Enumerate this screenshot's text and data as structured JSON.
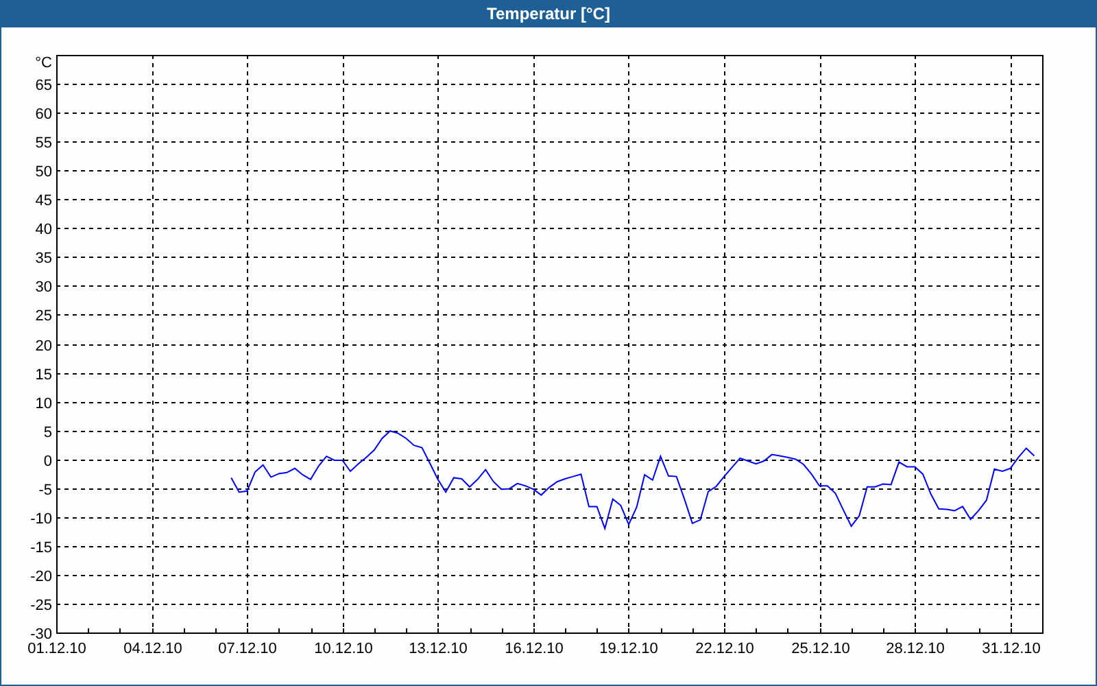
{
  "window": {
    "title": "Temperatur [°C]"
  },
  "chart": {
    "chart_data": {
      "type": "line",
      "grid": true,
      "ylabel": "°C",
      "ylim": [
        -30,
        70
      ],
      "categories": [
        "01.12.10",
        null,
        null,
        null,
        null,
        null,
        null,
        null,
        null,
        null,
        null,
        null,
        "04.12.10",
        null,
        null,
        null,
        null,
        null,
        null,
        null,
        null,
        null,
        null,
        null,
        "07.12.10",
        null,
        null,
        null,
        null,
        null,
        null,
        null,
        null,
        null,
        null,
        null,
        "10.12.10",
        null,
        null,
        null,
        null,
        null,
        null,
        null,
        null,
        null,
        null,
        null,
        "13.12.10",
        null,
        null,
        null,
        null,
        null,
        null,
        null,
        null,
        null,
        null,
        null,
        "16.12.10",
        null,
        null,
        null,
        null,
        null,
        null,
        null,
        null,
        null,
        null,
        null,
        "19.12.10",
        null,
        null,
        null,
        null,
        null,
        null,
        null,
        null,
        null,
        null,
        null,
        "22.12.10",
        null,
        null,
        null,
        null,
        null,
        null,
        null,
        null,
        null,
        null,
        null,
        "25.12.10",
        null,
        null,
        null,
        null,
        null,
        null,
        null,
        null,
        null,
        null,
        null,
        "28.12.10",
        null,
        null,
        null,
        null,
        null,
        null,
        null,
        null,
        null,
        null,
        null,
        "31.12.10",
        null,
        null,
        null
      ],
      "yticks": [
        -30,
        -25,
        -20,
        -15,
        -10,
        -5,
        0,
        5,
        10,
        15,
        20,
        25,
        30,
        35,
        40,
        45,
        50,
        55,
        60,
        65
      ],
      "series": [
        {
          "color": "#0000ff",
          "values": [
            null,
            null,
            null,
            null,
            null,
            null,
            null,
            null,
            null,
            null,
            null,
            null,
            null,
            null,
            null,
            null,
            null,
            null,
            null,
            null,
            null,
            null,
            -3.2,
            -5.7,
            -5.5,
            -2.2,
            -1.0,
            -3.1,
            -2.5,
            -2.3,
            -1.6,
            -2.7,
            -3.5,
            -1.2,
            0.5,
            -0.2,
            -0.2,
            -2.1,
            -0.8,
            0.3,
            1.6,
            3.6,
            4.9,
            4.5,
            3.6,
            2.4,
            2.0,
            -0.7,
            -3.5,
            -5.7,
            -3.2,
            -3.4,
            -4.8,
            -3.5,
            -1.8,
            -3.9,
            -5.2,
            -5.1,
            -4.2,
            -4.6,
            -5.2,
            -6.2,
            -4.9,
            -3.9,
            -3.4,
            -3.0,
            -2.6,
            -8.2,
            -8.2,
            -12.0,
            -6.9,
            -8.0,
            -11.3,
            -8.3,
            -2.7,
            -3.6,
            0.5,
            -2.9,
            -3.0,
            -6.9,
            -11.1,
            -10.5,
            -5.6,
            -4.7,
            -3.0,
            -1.4,
            0.2,
            -0.3,
            -0.8,
            -0.3,
            0.8,
            0.6,
            0.3,
            0.0,
            -0.9,
            -2.6,
            -4.6,
            -4.6,
            -5.9,
            -8.8,
            -11.6,
            -9.8,
            -4.8,
            -4.8,
            -4.3,
            -4.4,
            -0.5,
            -1.3,
            -1.3,
            -2.6,
            -6.0,
            -8.6,
            -8.7,
            -8.9,
            -8.2,
            -10.4,
            -8.9,
            -7.1,
            -1.7,
            -2.1,
            -1.6,
            0.3,
            1.9,
            0.6
          ]
        }
      ]
    }
  }
}
